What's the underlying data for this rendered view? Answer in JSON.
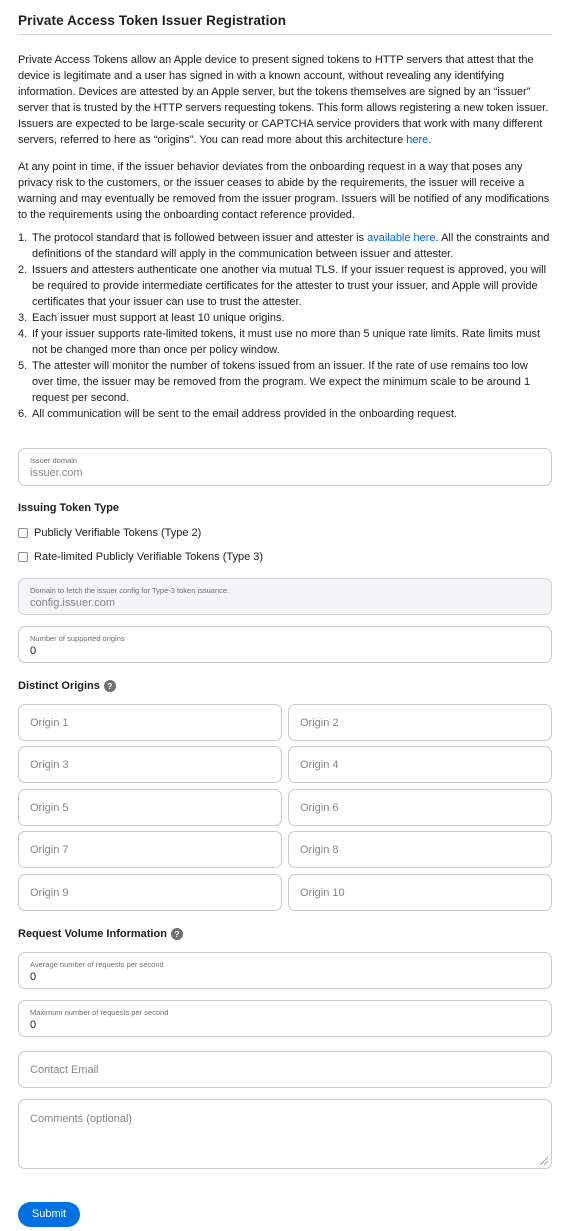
{
  "title": "Private Access Token Issuer Registration",
  "intro": {
    "p1_before_link": "Private Access Tokens allow an Apple device to present signed tokens to HTTP servers that attest that the device is legitimate and a user has signed in with a known account, without revealing any identifying information. Devices are attested by an Apple server, but the tokens themselves are signed by an “issuer” server that is trusted by the HTTP servers requesting tokens. This form allows registering a new token issuer. Issuers are expected to be large-scale security or CAPTCHA service providers that work with many different servers, referred to here as “origins”. You can read more about this architecture ",
    "p1_link": "here",
    "p1_after_link": ".",
    "p2": "At any point in time, if the issuer behavior deviates from the onboarding request in a way that poses any privacy risk to the customers, or the issuer ceases to abide by the requirements, the issuer will receive a warning and may eventually be removed from the issuer program. Issuers will be notified of any modifications to the requirements using the onboarding contact reference provided."
  },
  "requirements": [
    {
      "num": "1.",
      "before": "The protocol standard that is followed between issuer and attester is ",
      "link": "available here",
      "after": ". All the constraints and definitions of the standard will apply in the communication between issuer and attester."
    },
    {
      "num": "2.",
      "before": "Issuers and attesters authenticate one another via mutual TLS. If your issuer request is approved, you will be required to provide intermediate certificates for the attester to trust your issuer, and Apple will provide certificates that your issuer can use to trust the attester.",
      "link": "",
      "after": ""
    },
    {
      "num": "3.",
      "before": "Each issuer must support at least 10 unique origins.",
      "link": "",
      "after": ""
    },
    {
      "num": "4.",
      "before": "If your issuer supports rate-limited tokens, it must use no more than 5 unique rate limits. Rate limits must not be changed more than once per policy window.",
      "link": "",
      "after": ""
    },
    {
      "num": "5.",
      "before": "The attester will monitor the number of tokens issued from an issuer. If the rate of use remains too low over time, the issuer may be removed from the program. We expect the minimum scale to be around 1 request per second.",
      "link": "",
      "after": ""
    },
    {
      "num": "6.",
      "before": "All communication will be sent to the email address provided in the onboarding request.",
      "link": "",
      "after": ""
    }
  ],
  "issuer_domain": {
    "label": "Issuer domain",
    "placeholder": "issuer.com"
  },
  "token_type": {
    "heading": "Issuing Token Type",
    "options": [
      {
        "label": "Publicly Verifiable Tokens (Type 2)",
        "checked": false
      },
      {
        "label": "Rate-limited Publicly Verifiable Tokens (Type 3)",
        "checked": false
      }
    ]
  },
  "config_domain": {
    "label": "Domain to fetch the issuer config for Type-3 token issuance.",
    "placeholder": "config.issuer.com"
  },
  "num_origins": {
    "label": "Number of supported origins",
    "value": "0"
  },
  "origins": {
    "heading": "Distinct Origins",
    "help": "?",
    "placeholders": [
      "Origin 1",
      "Origin 2",
      "Origin 3",
      "Origin 4",
      "Origin 5",
      "Origin 6",
      "Origin 7",
      "Origin 8",
      "Origin 9",
      "Origin 10"
    ]
  },
  "volume": {
    "heading": "Request Volume Information",
    "help": "?",
    "avg_label": "Average number of requests per second",
    "avg_value": "0",
    "max_label": "Maximum number of requests per second",
    "max_value": "0"
  },
  "contact_email": {
    "placeholder": "Contact Email"
  },
  "comments": {
    "placeholder": "Comments (optional)"
  },
  "submit_label": "Submit",
  "colors": {
    "accent": "#0071e3",
    "link": "#0066cc",
    "border": "#c9c9ce"
  }
}
